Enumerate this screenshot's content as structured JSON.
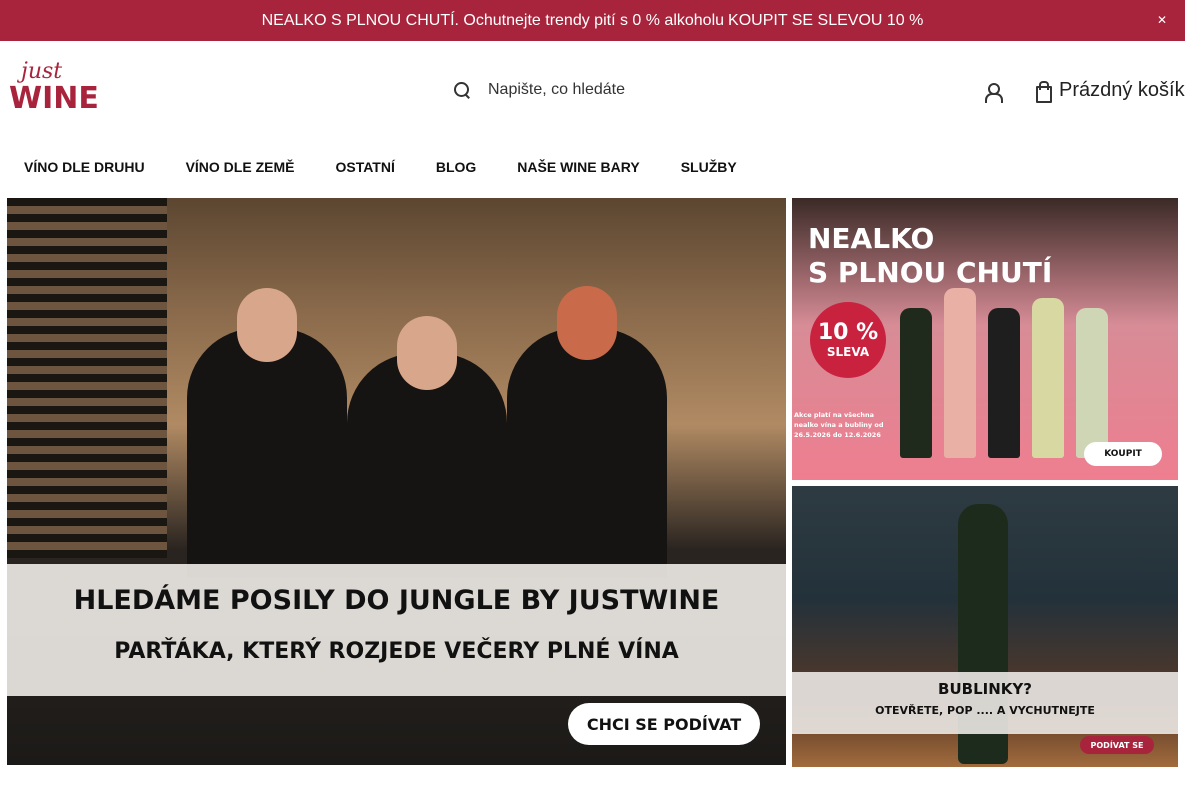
{
  "announcement": {
    "text": "NEALKO S PLNOU CHUTÍ. Ochutnejte trendy pití s 0 % alkoholu",
    "cta_label": "KOUPIT SE SLEVOU 10 %",
    "close_icon": "close-icon",
    "background_color": "#a8243c"
  },
  "header": {
    "logo": {
      "top_text": "just",
      "bottom_text": "WINE"
    },
    "search": {
      "placeholder": "Napište, co hledáte",
      "icon": "search-icon"
    },
    "account_icon": "user-icon",
    "cart": {
      "label": "Prázdný košík",
      "icon": "cart-icon"
    }
  },
  "nav": {
    "items": [
      {
        "label": "VÍNO DLE DRUHU"
      },
      {
        "label": "VÍNO DLE ZEMĚ"
      },
      {
        "label": "OSTATNÍ"
      },
      {
        "label": "BLOG"
      },
      {
        "label": "NAŠE WINE BARY"
      },
      {
        "label": "SLUŽBY"
      }
    ]
  },
  "banners": {
    "main": {
      "headline": "HLEDÁME POSILY DO JUNGLE BY JUSTWINE",
      "subheadline": "PARŤÁKA, KTERÝ ROZJEDE VEČERY PLNÉ VÍNA",
      "button_label": "CHCI SE PODÍVAT"
    },
    "side_top": {
      "title_line1": "NEALKO",
      "title_line2": "S PLNOU CHUTÍ",
      "badge_percent": "10 %",
      "badge_label": "SLEVA",
      "fineprint": "Akce platí na všechna nealko vína a bubliny od 26.5.2026 do 12.6.2026",
      "button_label": "KOUPIT"
    },
    "side_bottom": {
      "title": "BUBLINKY?",
      "subtitle": "OTEVŘETE, POP .... A VYCHUTNEJTE",
      "button_label": "PODÍVAT SE"
    }
  }
}
